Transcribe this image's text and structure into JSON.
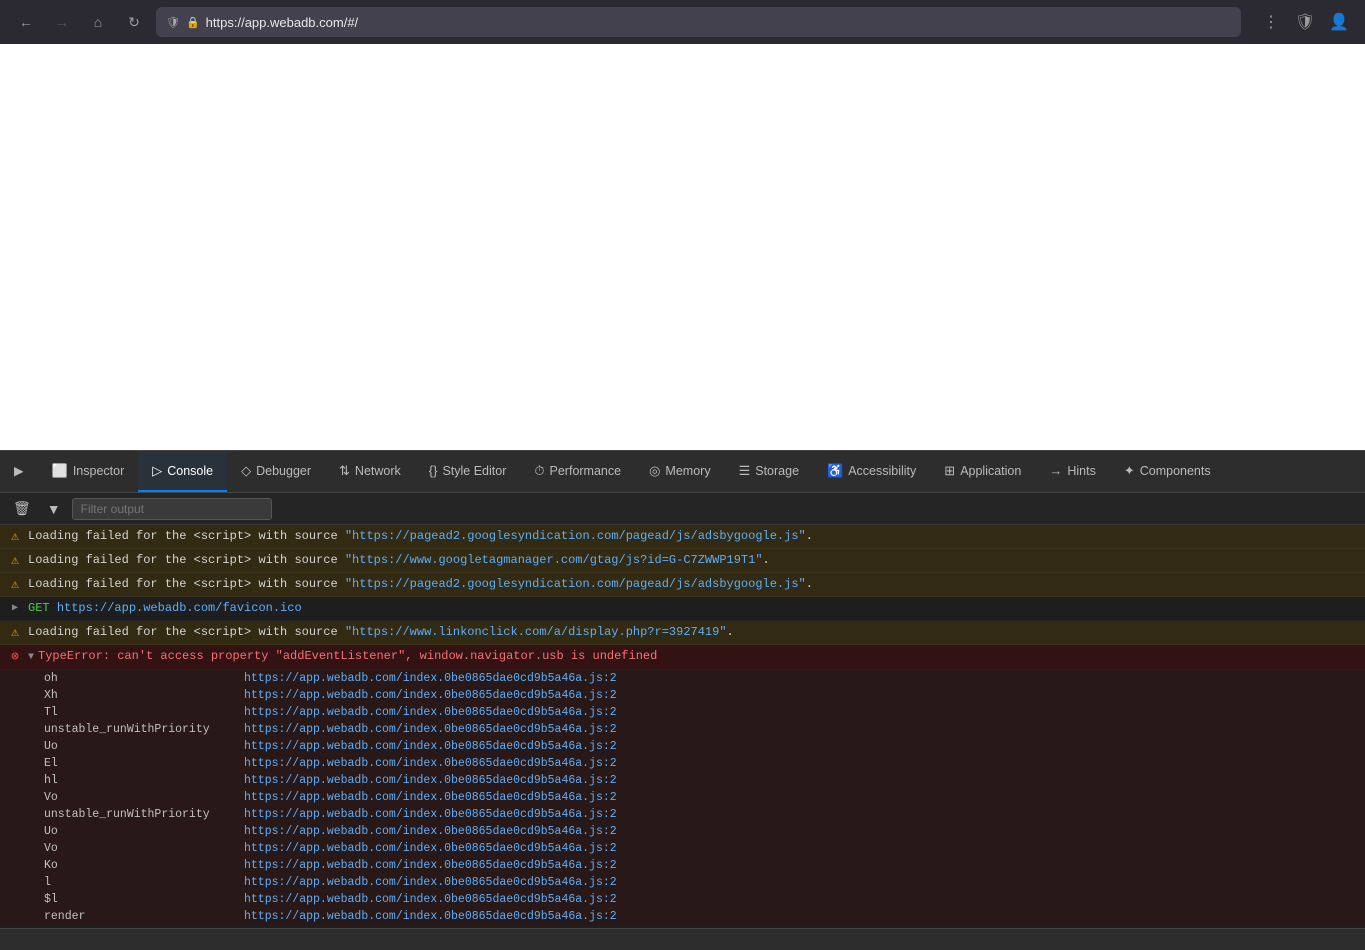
{
  "browser": {
    "url": "https://app.webadb.com/#/",
    "back_disabled": false,
    "forward_disabled": true
  },
  "devtools": {
    "tabs": [
      {
        "id": "inspector",
        "label": "Inspector",
        "icon": "⬜",
        "active": false
      },
      {
        "id": "console",
        "label": "Console",
        "icon": "▷",
        "active": true
      },
      {
        "id": "debugger",
        "label": "Debugger",
        "icon": "◇",
        "active": false
      },
      {
        "id": "network",
        "label": "Network",
        "icon": "↑↓",
        "active": false
      },
      {
        "id": "style-editor",
        "label": "Style Editor",
        "icon": "{}",
        "active": false
      },
      {
        "id": "performance",
        "label": "Performance",
        "icon": "⏱",
        "active": false
      },
      {
        "id": "memory",
        "label": "Memory",
        "icon": "◎",
        "active": false
      },
      {
        "id": "storage",
        "label": "Storage",
        "icon": "☰",
        "active": false
      },
      {
        "id": "accessibility",
        "label": "Accessibility",
        "icon": "♿",
        "active": false
      },
      {
        "id": "application",
        "label": "Application",
        "icon": "⊞",
        "active": false
      },
      {
        "id": "hints",
        "label": "Hints",
        "icon": "→",
        "active": false
      },
      {
        "id": "components",
        "label": "Components",
        "icon": "✦",
        "active": false
      }
    ],
    "toolbar": {
      "filter_placeholder": "Filter output"
    },
    "messages": [
      {
        "type": "warning",
        "text": "Loading failed for the <script> with source “https://pagead2.googlesyndication.com/pagead/js/adsbygoogle.js”."
      },
      {
        "type": "warning",
        "text": "Loading failed for the <script> with source “https://www.googletagmanager.com/gtag/js?id=G-C7ZWWP19T1”."
      },
      {
        "type": "warning",
        "text": "Loading failed for the <script> with source “https://pagead2.googlesyndication.com/pagead/js/adsbygoogle.js”."
      },
      {
        "type": "get",
        "method": "GET",
        "url": "https://app.webadb.com/favicon.ico"
      },
      {
        "type": "warning",
        "text": "Loading failed for the <script> with source “https://www.linkonclick.com/a/display.php?r=3927419”."
      },
      {
        "type": "error",
        "main": "TypeError: can’t access property “addEventListener”, window.navigator.usb is undefined",
        "expanded": true,
        "stack": [
          {
            "fn": "oh",
            "file": "https://app.webadb.com/index.0be0865dae0cd9b5a46a.js:2"
          },
          {
            "fn": "Xh",
            "file": "https://app.webadb.com/index.0be0865dae0cd9b5a46a.js:2"
          },
          {
            "fn": "Tl",
            "file": "https://app.webadb.com/index.0be0865dae0cd9b5a46a.js:2"
          },
          {
            "fn": "unstable_runWithPriority",
            "file": "https://app.webadb.com/index.0be0865dae0cd9b5a46a.js:2"
          },
          {
            "fn": "Uo",
            "file": "https://app.webadb.com/index.0be0865dae0cd9b5a46a.js:2"
          },
          {
            "fn": "El",
            "file": "https://app.webadb.com/index.0be0865dae0cd9b5a46a.js:2"
          },
          {
            "fn": "hl",
            "file": "https://app.webadb.com/index.0be0865dae0cd9b5a46a.js:2"
          },
          {
            "fn": "Vo",
            "file": "https://app.webadb.com/index.0be0865dae0cd9b5a46a.js:2"
          },
          {
            "fn": "unstable_runWithPriority",
            "file": "https://app.webadb.com/index.0be0865dae0cd9b5a46a.js:2"
          },
          {
            "fn": "Uo",
            "file": "https://app.webadb.com/index.0be0865dae0cd9b5a46a.js:2"
          },
          {
            "fn": "Vo",
            "file": "https://app.webadb.com/index.0be0865dae0cd9b5a46a.js:2"
          },
          {
            "fn": "Ko",
            "file": "https://app.webadb.com/index.0be0865dae0cd9b5a46a.js:2"
          },
          {
            "fn": "l",
            "file": "https://app.webadb.com/index.0be0865dae0cd9b5a46a.js:2"
          },
          {
            "fn": "$l",
            "file": "https://app.webadb.com/index.0be0865dae0cd9b5a46a.js:2"
          },
          {
            "fn": "render",
            "file": "https://app.webadb.com/index.0be0865dae0cd9b5a46a.js:2"
          }
        ]
      }
    ],
    "statusbar": {
      "text": ""
    }
  }
}
